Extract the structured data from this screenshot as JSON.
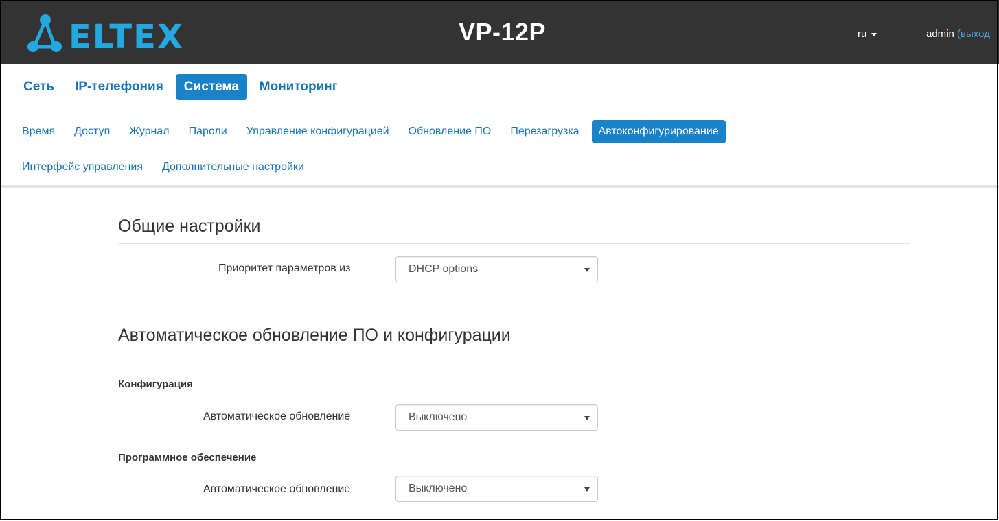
{
  "header": {
    "logo_text": "ELTEX",
    "device": "VP-12P",
    "language": "ru",
    "user": "admin",
    "logout": "(выход"
  },
  "main_nav": [
    {
      "label": "Сеть",
      "active": false
    },
    {
      "label": "IP-телефония",
      "active": false
    },
    {
      "label": "Система",
      "active": true
    },
    {
      "label": "Мониторинг",
      "active": false
    }
  ],
  "sub_nav": [
    {
      "label": "Время",
      "active": false
    },
    {
      "label": "Доступ",
      "active": false
    },
    {
      "label": "Журнал",
      "active": false
    },
    {
      "label": "Пароли",
      "active": false
    },
    {
      "label": "Управление конфигурацией",
      "active": false
    },
    {
      "label": "Обновление ПО",
      "active": false
    },
    {
      "label": "Перезагрузка",
      "active": false
    },
    {
      "label": "Автоконфигурирование",
      "active": true
    },
    {
      "label": "Интерфейс управления",
      "active": false
    },
    {
      "label": "Дополнительные настройки",
      "active": false
    }
  ],
  "general": {
    "title": "Общие настройки",
    "priority_label": "Приоритет параметров из",
    "priority_value": "DHCP options"
  },
  "auto_update": {
    "title": "Автоматическое обновление ПО и конфигурации",
    "config_group": "Конфигурация",
    "config_label": "Автоматическое обновление",
    "config_value": "Выключено",
    "software_group": "Программное обеспечение",
    "software_label": "Автоматическое обновление",
    "software_value": "Выключено"
  },
  "colors": {
    "header_bg": "#333333",
    "brand": "#23a8e0",
    "link": "#1a75b7",
    "active_bg": "#1a82c8"
  },
  "icons": [
    "eltex-logo",
    "caret-down-icon",
    "select-arrow-icon"
  ]
}
